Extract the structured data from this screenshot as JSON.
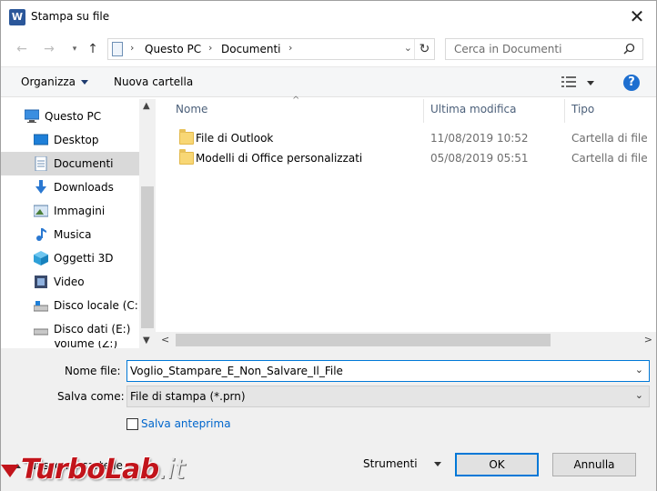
{
  "window": {
    "title": "Stampa su file",
    "app_icon_letter": "W"
  },
  "address_bar": {
    "segments": [
      "Questo PC",
      "Documenti"
    ],
    "search_placeholder": "Cerca in Documenti"
  },
  "toolbar": {
    "organize_label": "Organizza",
    "new_folder_label": "Nuova cartella"
  },
  "nav_pane": {
    "items": [
      {
        "label": "Questo PC",
        "icon": "computer-icon"
      },
      {
        "label": "Desktop",
        "icon": "desktop-icon"
      },
      {
        "label": "Documenti",
        "icon": "documents-icon",
        "selected": true
      },
      {
        "label": "Downloads",
        "icon": "download-icon"
      },
      {
        "label": "Immagini",
        "icon": "pictures-icon"
      },
      {
        "label": "Musica",
        "icon": "music-icon"
      },
      {
        "label": "Oggetti 3D",
        "icon": "3d-objects-icon"
      },
      {
        "label": "Video",
        "icon": "video-icon"
      },
      {
        "label": "Disco locale (C:)",
        "icon": "drive-icon"
      },
      {
        "label": "Disco dati (E:)",
        "icon": "drive-icon"
      },
      {
        "label": "Volume (Z:)",
        "icon": "drive-icon"
      }
    ]
  },
  "file_list": {
    "columns": {
      "name": "Nome",
      "modified": "Ultima modifica",
      "type": "Tipo"
    },
    "rows": [
      {
        "name": "File di Outlook",
        "modified": "11/08/2019 10:52",
        "type": "Cartella di file"
      },
      {
        "name": "Modelli di Office personalizzati",
        "modified": "05/08/2019 05:51",
        "type": "Cartella di file"
      }
    ]
  },
  "form": {
    "filename_label": "Nome file:",
    "filename_value": "Voglio_Stampare_E_Non_Salvare_Il_File",
    "save_as_label": "Salva come:",
    "save_as_value": "File di stampa (*.prn)",
    "preview_label": "Salva anteprima",
    "preview_checked": false
  },
  "footer": {
    "hide_folders_label": "Nascondi cartelle",
    "tools_label": "Strumenti",
    "ok_label": "OK",
    "cancel_label": "Annulla"
  },
  "watermark": {
    "text_strong": "TurboLab",
    "text_light": ".it"
  },
  "colors": {
    "accent": "#0078d7",
    "link": "#0066cc",
    "folder": "#f8d775",
    "watermark": "#c2141b"
  }
}
